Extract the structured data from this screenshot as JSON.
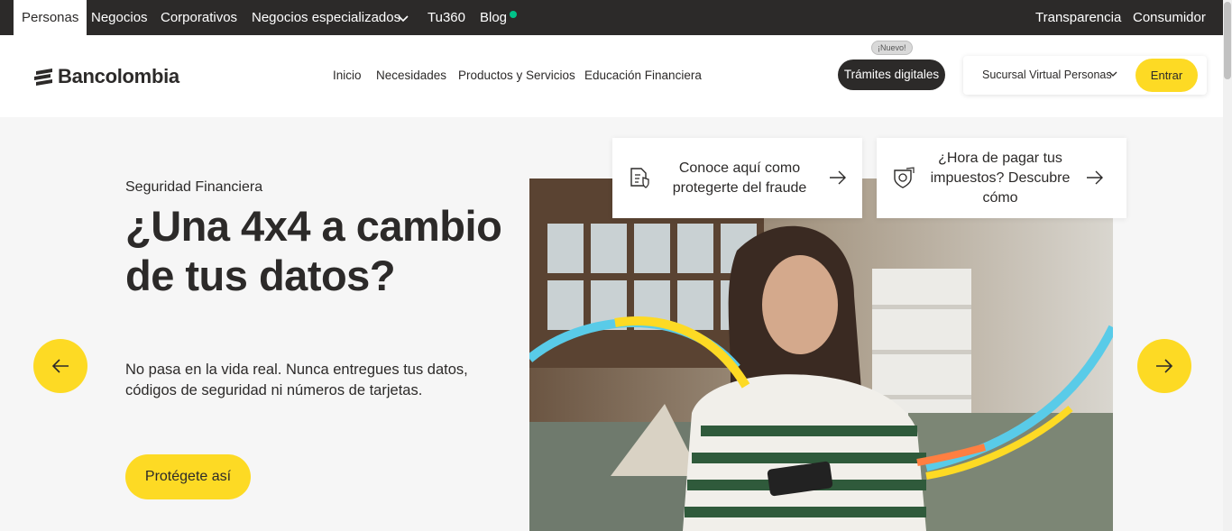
{
  "topbar": {
    "items": [
      "Personas",
      "Negocios",
      "Corporativos",
      "Negocios especializados",
      "Tu360",
      "Blog"
    ],
    "right": [
      "Transparencia",
      "Consumidor"
    ],
    "colors": {
      "background": "#2c2a29",
      "blog_dot": "#00c389"
    }
  },
  "header": {
    "brand": "Bancolombia",
    "nav": [
      "Inicio",
      "Necesidades",
      "Productos y Servicios",
      "Educación Financiera"
    ],
    "nuevo_badge": "¡Nuevo!",
    "tramites": "Trámites digitales",
    "sucursal": "Sucursal Virtual Personas",
    "entrar": "Entrar"
  },
  "hero": {
    "eyebrow": "Seguridad Financiera",
    "headline": "¿Una 4x4 a cambio de tus datos?",
    "description": "No pasa en la vida real. Nunca entregues tus datos, códigos de seguridad ni números de tarjetas.",
    "cta": "Protégete así",
    "cards": [
      {
        "icon": "document-shield-icon",
        "text": "Conoce aquí como protegerte del fraude"
      },
      {
        "icon": "tax-receipt-icon",
        "text": "¿Hora de pagar tus impuestos? Descubre cómo"
      }
    ],
    "image_subject": "woman-looking-at-phone-photo"
  },
  "colors": {
    "brand_yellow": "#fdda24",
    "dark": "#2c2a29",
    "hero_bg": "#f6f6f6",
    "arc_blue": "#59cbe8",
    "arc_orange": "#ff7f41"
  }
}
